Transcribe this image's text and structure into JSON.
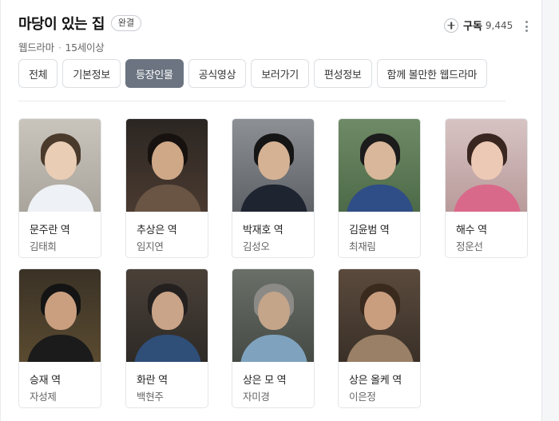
{
  "header": {
    "title": "마당이 있는 집",
    "status_badge": "완결",
    "genre": "웹드라마",
    "rating": "15세이상"
  },
  "subscribe": {
    "label": "구독",
    "count": "9,445",
    "icon": "plus-icon"
  },
  "more_icon": "more-vertical-icon",
  "tabs": [
    {
      "label": "전체",
      "active": false
    },
    {
      "label": "기본정보",
      "active": false
    },
    {
      "label": "등장인물",
      "active": true
    },
    {
      "label": "공식영상",
      "active": false
    },
    {
      "label": "보러가기",
      "active": false
    },
    {
      "label": "편성정보",
      "active": false
    },
    {
      "label": "함께 볼만한 웹드라마",
      "active": false
    }
  ],
  "cast": [
    {
      "role": "문주란 역",
      "actor": "김태희"
    },
    {
      "role": "추상은 역",
      "actor": "임지연"
    },
    {
      "role": "박재호 역",
      "actor": "김성오"
    },
    {
      "role": "김윤범 역",
      "actor": "최재림"
    },
    {
      "role": "해수 역",
      "actor": "정운선"
    },
    {
      "role": "승재 역",
      "actor": "자성제"
    },
    {
      "role": "화란 역",
      "actor": "백현주"
    },
    {
      "role": "상은 모 역",
      "actor": "자미경"
    },
    {
      "role": "상은 올케 역",
      "actor": "이은정"
    }
  ]
}
